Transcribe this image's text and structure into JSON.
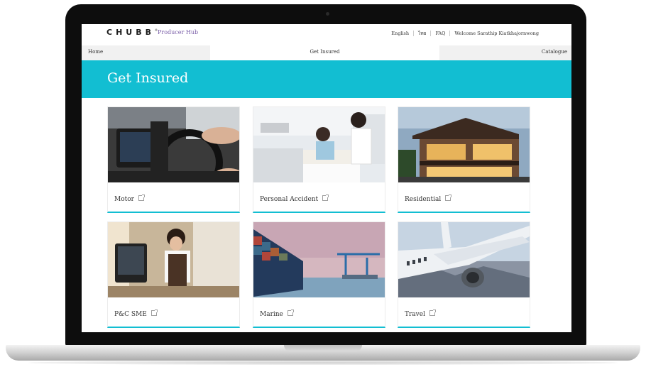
{
  "header": {
    "logo": "CHUBB",
    "logo_tm": "®",
    "product": "Producer Hub",
    "links": [
      "English",
      "ไทย",
      "FAQ"
    ],
    "welcome": "Welcome Sarathip Kiatkhajornwong"
  },
  "nav": {
    "home": "Home",
    "get_insured": "Get Insured",
    "catalogue": "Catalogue"
  },
  "hero": {
    "title": "Get Insured"
  },
  "products": [
    {
      "label": "Motor",
      "image": "car-dashboard-image"
    },
    {
      "label": "Personal Accident",
      "image": "hospital-patient-image"
    },
    {
      "label": "Residential",
      "image": "modern-house-image"
    },
    {
      "label": "P&C SME",
      "image": "cafe-owner-image"
    },
    {
      "label": "Marine",
      "image": "cargo-ship-image"
    },
    {
      "label": "Travel",
      "image": "airplane-wing-image"
    }
  ],
  "colors": {
    "accent": "#12bed2",
    "hub_purple": "#7a5ea8"
  }
}
